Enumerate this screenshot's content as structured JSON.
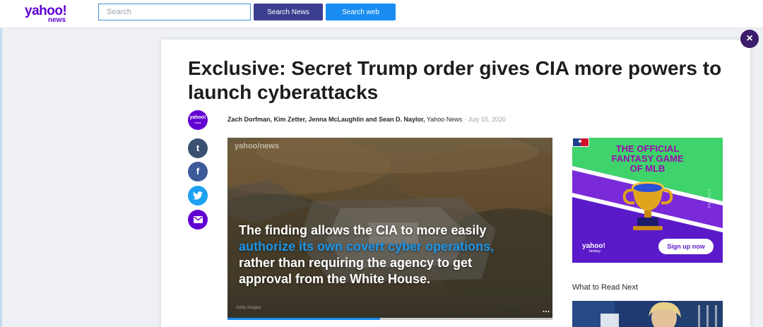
{
  "header": {
    "logo_main": "yahoo!",
    "logo_sub": "news",
    "search_placeholder": "Search",
    "search_news_label": "Search News",
    "search_web_label": "Search web"
  },
  "close_label": "×",
  "article": {
    "headline": "Exclusive: Secret Trump order gives CIA more powers to launch cyberattacks",
    "avatar_main": "yahoo!",
    "avatar_sub": "news",
    "authors": "Zach Dorfman, Kim Zetter, Jenna McLaughlin and Sean D. Naylor,",
    "source": "Yahoo News",
    "separator": "·",
    "date": "July 15, 2020"
  },
  "share": {
    "tumblr_glyph": "t",
    "facebook_glyph": "f",
    "twitter_glyph": "🐦",
    "email_glyph": "✉",
    "icons": [
      "tumblr-icon",
      "facebook-icon",
      "twitter-icon",
      "email-icon"
    ]
  },
  "video": {
    "watermark": "yahoo/news",
    "caption_line1": "The finding allows the CIA to more easily",
    "caption_highlight": "authorize its own covert cyber operations,",
    "caption_line3": "rather than requiring the agency to get",
    "caption_line4": "approval from the White House.",
    "credit": "Getty Images",
    "progress_percent": 47,
    "highlight_color": "#1d95e8"
  },
  "ad": {
    "title_line1": "THE OFFICIAL",
    "title_line2": "FANTASY GAME",
    "title_line3": "OF MLB",
    "logo_main": "yahoo!",
    "logo_sub": "fantasy",
    "copyright": "© 2020 MLB",
    "signup_label": "Sign up now",
    "brand_color": "#5a1ac9"
  },
  "sidebar": {
    "what_to_read": "What to Read Next"
  },
  "colors": {
    "yahoo_purple": "#6001d2",
    "search_news_btn": "#3c3f8f",
    "search_web_btn": "#1a8df2",
    "close_btn": "#3b1b6b"
  }
}
